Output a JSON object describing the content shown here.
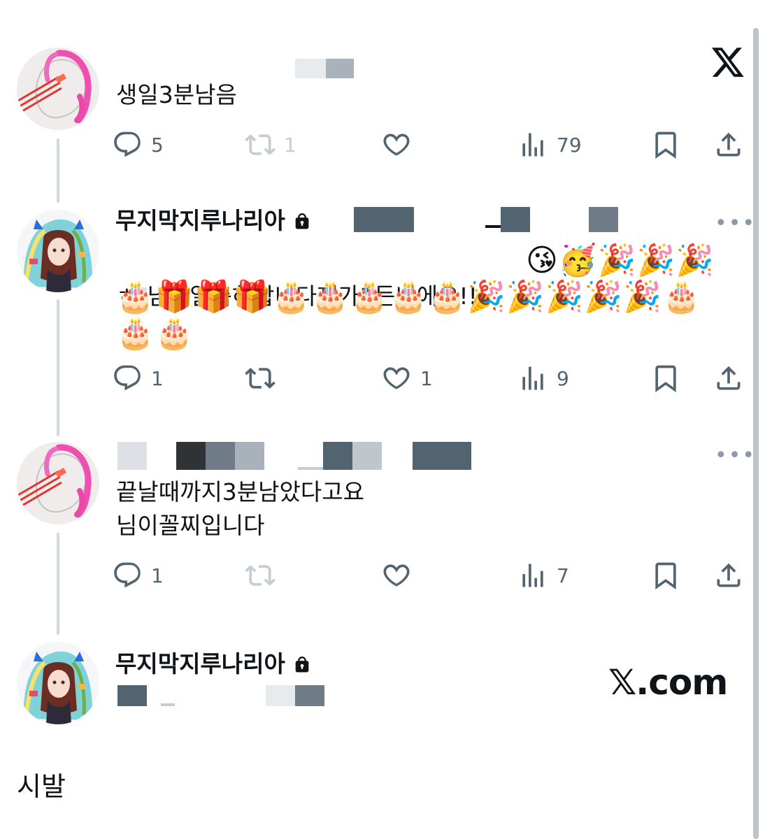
{
  "brand": {
    "logo_icon": "x-logo-icon",
    "watermark": "𝕏.com"
  },
  "tweets": [
    {
      "text": "생일3분남음",
      "actions": {
        "replies": "5",
        "reposts": "1",
        "likes": "",
        "views": "79"
      }
    },
    {
      "name": "무지막지루나리아",
      "text": "님생일축하합니다재가1든니에요!!",
      "text_prefix": "ㅎ",
      "emoji_line1": "😘🥳🎉🎉🎉",
      "emoji_line2": "🎂🎁🎁🎁🎂🎂🎂🎂🎂🎉🎉🎉🎉🎉🎂",
      "emoji_line3": "🎂🎂",
      "actions": {
        "replies": "1",
        "reposts": "",
        "likes": "1",
        "views": "9"
      }
    },
    {
      "text": "끝날때까지3분남았다고요\n님이꼴찌입니다",
      "actions": {
        "replies": "1",
        "reposts": "",
        "likes": "",
        "views": "7"
      }
    },
    {
      "name": "무지막지루나리아"
    }
  ],
  "bottom_text": "시발",
  "colors": {
    "text": "#0f1419",
    "icon": "#536471",
    "thread": "#cfd9de",
    "redact_dark": "#536471",
    "redact_light": "#dde1e5"
  }
}
